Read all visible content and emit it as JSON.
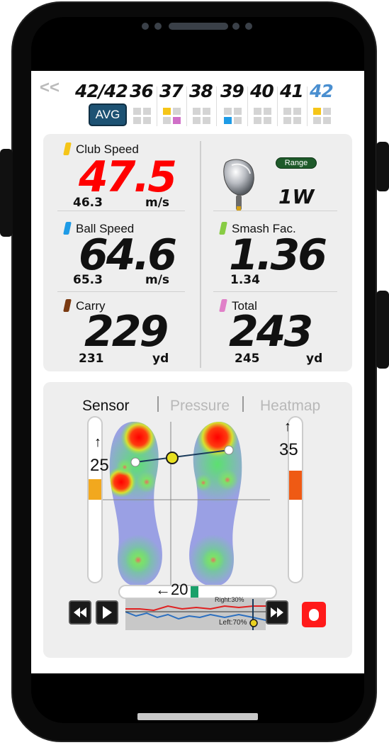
{
  "shots": {
    "back": "<<",
    "current": "42/42",
    "avg_label": "AVG",
    "items": [
      {
        "number": "36",
        "color": "#111111"
      },
      {
        "number": "37",
        "color": "#111111"
      },
      {
        "number": "38",
        "color": "#111111"
      },
      {
        "number": "39",
        "color": "#111111"
      },
      {
        "number": "40",
        "color": "#111111"
      },
      {
        "number": "41",
        "color": "#111111"
      },
      {
        "number": "42",
        "color": "#4a8fd0"
      }
    ]
  },
  "metrics": {
    "club_speed": {
      "label": "Club Speed",
      "value": "47.5",
      "avg": "46.3",
      "unit": "m/s",
      "color": "#f5c518",
      "value_color": "#ff0000"
    },
    "ball_speed": {
      "label": "Ball Speed",
      "value": "64.6",
      "avg": "65.3",
      "unit": "m/s",
      "color": "#1e9be6"
    },
    "carry": {
      "label": "Carry",
      "value": "229",
      "avg": "231",
      "unit": "yd",
      "color": "#7a3a12"
    },
    "smash": {
      "label": "Smash Fac.",
      "value": "1.36",
      "avg": "1.34",
      "color": "#88cc44"
    },
    "total": {
      "label": "Total",
      "value": "243",
      "avg": "245",
      "unit": "yd",
      "color": "#e080c8"
    },
    "club": {
      "range_label": "Range",
      "club_name": "1W"
    }
  },
  "sensor": {
    "tabs": {
      "sensor": "Sensor",
      "pressure": "Pressure",
      "heatmap": "Heatmap"
    },
    "left_value": "25",
    "right_value": "35",
    "bottom_value": "20",
    "left_up_arrow": "↑",
    "right_up_arrow": "↑",
    "bottom_arrow": "←",
    "graph_right_label": "Right:30%",
    "graph_left_label": "Left:70%"
  }
}
